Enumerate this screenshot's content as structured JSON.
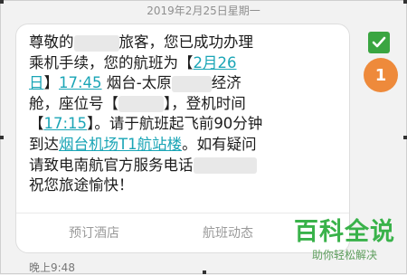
{
  "header": {
    "date_text": "2019年2月25日星期一"
  },
  "message": {
    "line1_a": "尊敬的",
    "line1_b": "旅客，您已成功办理",
    "line2": "乘机手续，您的航班为【",
    "line2_link": "2月26",
    "line3_link": "日",
    "line3_a": "】",
    "line3_link2": "17:45",
    "line3_b": " 烟台-太原",
    "line3_c": "经济",
    "line4_a": "舱，座位号【",
    "line4_b": "】，登机时间",
    "line5_a": "【",
    "line5_link": "17:15",
    "line5_b": "】。请于航班起飞前90分钟",
    "line6_a": "到达",
    "line6_link": "烟台机场T1航站楼",
    "line6_b": "。如有疑问",
    "line7": "请致电南航官方服务电话",
    "line8": "祝您旅途愉快！"
  },
  "actions": {
    "hotel": "预订酒店",
    "flight_status": "航班动态"
  },
  "footer": {
    "time": "晚上9:48"
  },
  "badge": {
    "number": "1"
  },
  "watermark": {
    "title": "百科全说",
    "subtitle": "助你轻松解决"
  },
  "colors": {
    "link": "#1aa5b6",
    "check": "#3aa541",
    "badge": "#ee8a3b",
    "watermark": "#39b24a"
  }
}
